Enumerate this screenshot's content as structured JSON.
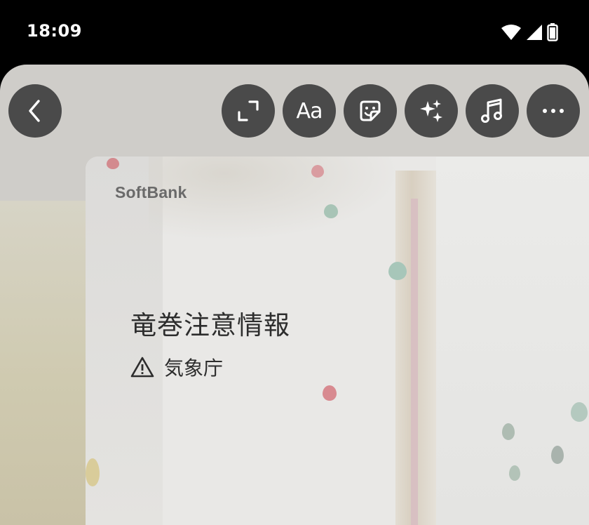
{
  "status_bar": {
    "time": "18:09",
    "icons": [
      "wifi-icon",
      "signal-icon",
      "battery-icon"
    ]
  },
  "toolbar": {
    "back": {
      "icon": "chevron-left-icon"
    },
    "buttons": [
      {
        "name": "resize",
        "icon": "expand-icon"
      },
      {
        "name": "text",
        "label": "Aa"
      },
      {
        "name": "sticker",
        "icon": "sticker-icon"
      },
      {
        "name": "effects",
        "icon": "sparkles-icon"
      },
      {
        "name": "music",
        "icon": "music-note-icon"
      },
      {
        "name": "more",
        "icon": "more-horizontal-icon"
      }
    ]
  },
  "story": {
    "brand": "SoftBank",
    "alert_title": "竜巻注意情報",
    "alert_source": "気象庁",
    "alert_icon": "warning-triangle-icon"
  },
  "colors": {
    "button_bg": "#4a4a4a",
    "surface": "#cfcdc9",
    "text_dark": "#2d2d2d",
    "brand_gray": "#6a6a6a"
  }
}
